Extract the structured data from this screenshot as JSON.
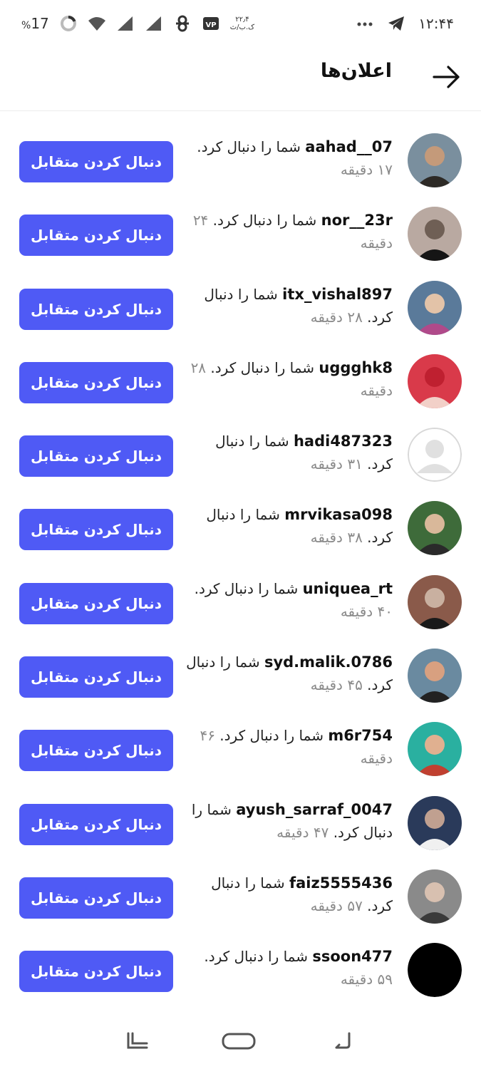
{
  "status_bar": {
    "time": "۱۲:۴۴",
    "battery": "17",
    "battery_unit": "%",
    "speed_value": "۲۲٫۴",
    "speed_unit": "ک.ب/ث",
    "icons": [
      "telegram-icon",
      "more-dots-icon",
      "battery-icon",
      "wifi-icon",
      "signal-icon",
      "signal-icon",
      "app-icon",
      "vpn-icon"
    ]
  },
  "header": {
    "title": "اعلان‌ها",
    "back_icon": "arrow-right-icon"
  },
  "colors": {
    "accent": "#4f5af5",
    "time_text": "#8a8a8a"
  },
  "notifications": [
    {
      "username": "aahad__07",
      "action": "شما را دنبال کرد.",
      "time": "۱۷ دقیقه",
      "button": "دنبال کردن متقابل",
      "avatar": "photo"
    },
    {
      "username": "nor__23r",
      "action": "شما را دنبال کرد.",
      "time": "۲۴ دقیقه",
      "button": "دنبال کردن متقابل",
      "avatar": "photo"
    },
    {
      "username": "itx_vishal897",
      "action": "شما را دنبال کرد.",
      "time": "۲۸ دقیقه",
      "button": "دنبال کردن متقابل",
      "avatar": "photo"
    },
    {
      "username": "uggghk8",
      "action": "شما را دنبال کرد.",
      "time": "۲۸ دقیقه",
      "button": "دنبال کردن متقابل",
      "avatar": "photo"
    },
    {
      "username": "hadi487323",
      "action": "شما را دنبال کرد.",
      "time": "۳۱ دقیقه",
      "button": "دنبال کردن متقابل",
      "avatar": "default"
    },
    {
      "username": "mrvikasa098",
      "action": "شما را دنبال کرد.",
      "time": "۳۸ دقیقه",
      "button": "دنبال کردن متقابل",
      "avatar": "photo"
    },
    {
      "username": "uniquea_rt",
      "action": "شما را دنبال کرد.",
      "time": "۴۰ دقیقه",
      "button": "دنبال کردن متقابل",
      "avatar": "photo"
    },
    {
      "username": "syd.malik.0786",
      "action": "شما را دنبال کرد.",
      "time": "۴۵ دقیقه",
      "button": "دنبال کردن متقابل",
      "avatar": "photo"
    },
    {
      "username": "m6r754",
      "action": "شما را دنبال کرد.",
      "time": "۴۶ دقیقه",
      "button": "دنبال کردن متقابل",
      "avatar": "photo"
    },
    {
      "username": "ayush_sarraf_0047",
      "action": "شما را دنبال کرد.",
      "time": "۴۷ دقیقه",
      "button": "دنبال کردن متقابل",
      "avatar": "photo"
    },
    {
      "username": "faiz5555436",
      "action": "شما را دنبال کرد.",
      "time": "۵۷ دقیقه",
      "button": "دنبال کردن متقابل",
      "avatar": "photo"
    },
    {
      "username": "ssoon477",
      "action": "شما را دنبال کرد.",
      "time": "۵۹ دقیقه",
      "button": "دنبال کردن متقابل",
      "avatar": "black"
    }
  ],
  "nav_bar": {
    "icons": [
      "recent-apps-icon",
      "home-icon",
      "back-icon"
    ]
  }
}
